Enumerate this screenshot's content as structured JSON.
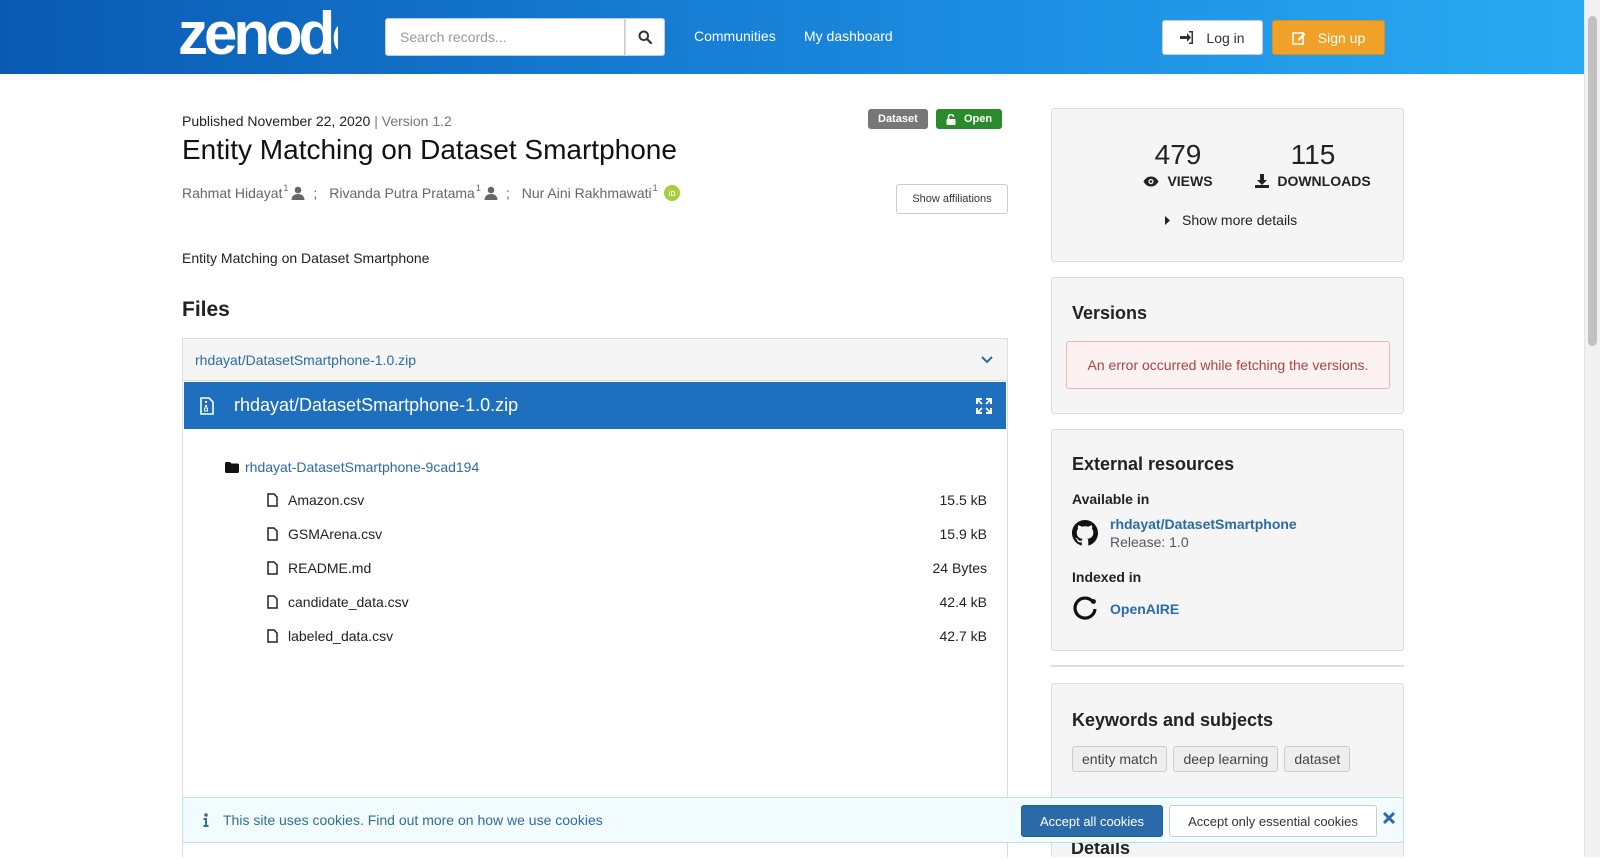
{
  "header": {
    "logo_text": "zenodo",
    "search_placeholder": "Search records...",
    "nav": [
      "Communities",
      "My dashboard"
    ],
    "login_label": "Log in",
    "signup_label": "Sign up"
  },
  "record": {
    "published": "Published November 22, 2020",
    "version_sep": " | ",
    "version": "Version 1.2",
    "type_badge": "Dataset",
    "access_badge": "Open",
    "title": "Entity Matching on Dataset Smartphone",
    "authors": [
      {
        "name": "Rahmat Hidayat",
        "affil": "1",
        "icon": "person-icon"
      },
      {
        "name": "Rivanda Putra Pratama",
        "affil": "1",
        "icon": "person-icon"
      },
      {
        "name": "Nur Aini Rakhmawati",
        "affil": "1",
        "icon": "orcid-icon"
      }
    ],
    "author_sep": ";",
    "show_affiliations": "Show affiliations",
    "description": "Entity Matching on Dataset Smartphone"
  },
  "files": {
    "heading": "Files",
    "archive_link": "rhdayat/DatasetSmartphone-1.0.zip",
    "preview_title": "rhdayat/DatasetSmartphone-1.0.zip",
    "folder": "rhdayat-DatasetSmartphone-9cad194",
    "items": [
      {
        "name": "Amazon.csv",
        "size": "15.5 kB"
      },
      {
        "name": "GSMArena.csv",
        "size": "15.9 kB"
      },
      {
        "name": "README.md",
        "size": "24 Bytes"
      },
      {
        "name": "candidate_data.csv",
        "size": "42.4 kB"
      },
      {
        "name": "labeled_data.csv",
        "size": "42.7 kB"
      }
    ]
  },
  "stats": {
    "views": "479",
    "views_label": "VIEWS",
    "downloads": "115",
    "downloads_label": "DOWNLOADS",
    "show_more": "Show more details"
  },
  "versions": {
    "title": "Versions",
    "error": "An error occurred while fetching the versions."
  },
  "external": {
    "title": "External resources",
    "available_label": "Available in",
    "github_link": "rhdayat/DatasetSmartphone",
    "github_release": "Release: 1.0",
    "indexed_label": "Indexed in",
    "openaire_link": "OpenAIRE"
  },
  "keywords": {
    "title": "Keywords and subjects",
    "items": [
      "entity match",
      "deep learning",
      "dataset"
    ]
  },
  "details": {
    "title": "Details"
  },
  "cookie": {
    "text": "This site uses cookies. Find out more on",
    "link": "how we use cookies",
    "accept_all": "Accept all cookies",
    "accept_essential": "Accept only essential cookies"
  },
  "colors": {
    "header_gradient_start": "#0a5ab2",
    "header_gradient_end": "#2aaaf2",
    "signup": "#f0a128",
    "open_badge": "#2b8a2b",
    "preview_bar": "#1f6fbf",
    "link": "#2a6ba8"
  }
}
